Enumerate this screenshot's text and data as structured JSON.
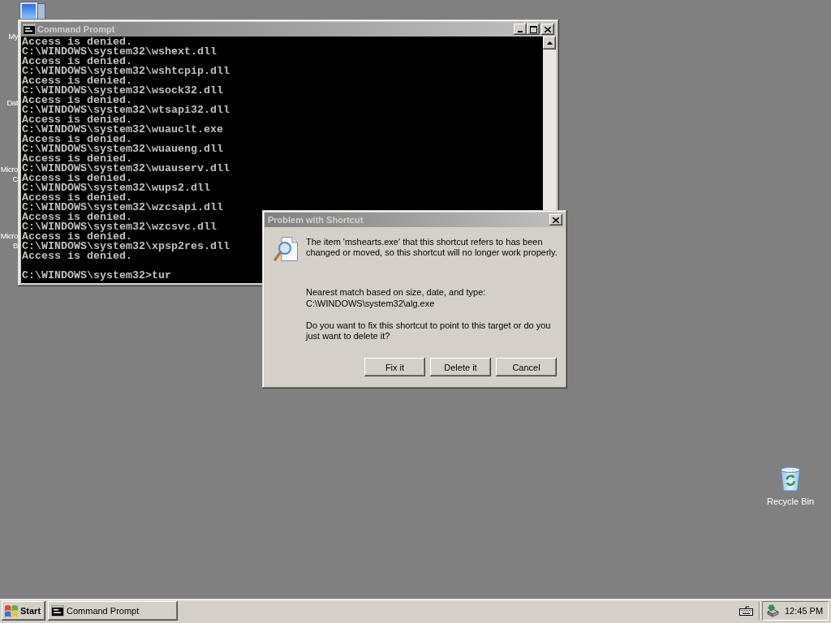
{
  "desktop": {
    "left_icons": [
      {
        "kind": "computer",
        "label_lines": [
          "My"
        ]
      },
      {
        "kind": "label_only",
        "label_lines": [
          "Dat"
        ]
      },
      {
        "kind": "label_only",
        "label_lines": [
          "Micro",
          "C"
        ]
      },
      {
        "kind": "label_only",
        "label_lines": [
          "Micro",
          "B"
        ]
      }
    ],
    "recycle_bin": {
      "label": "Recycle Bin"
    }
  },
  "console": {
    "title": "Command Prompt",
    "active": false,
    "output_lines": [
      "Access is denied.",
      "C:\\WINDOWS\\system32\\wshext.dll",
      "Access is denied.",
      "C:\\WINDOWS\\system32\\wshtcpip.dll",
      "Access is denied.",
      "C:\\WINDOWS\\system32\\wsock32.dll",
      "Access is denied.",
      "C:\\WINDOWS\\system32\\wtsapi32.dll",
      "Access is denied.",
      "C:\\WINDOWS\\system32\\wuauclt.exe",
      "Access is denied.",
      "C:\\WINDOWS\\system32\\wuaueng.dll",
      "Access is denied.",
      "C:\\WINDOWS\\system32\\wuauserv.dll",
      "Access is denied.",
      "C:\\WINDOWS\\system32\\wups2.dll",
      "Access is denied.",
      "C:\\WINDOWS\\system32\\wzcsapi.dll",
      "Access is denied.",
      "C:\\WINDOWS\\system32\\wzcsvc.dll",
      "Access is denied.",
      "C:\\WINDOWS\\system32\\xpsp2res.dll",
      "Access is denied."
    ],
    "prompt": "C:\\WINDOWS\\system32>tur"
  },
  "dialog": {
    "title": "Problem with Shortcut",
    "active": false,
    "message": "The item 'mshearts.exe' that this shortcut refers to has been changed or moved, so this shortcut will no longer work properly.",
    "match_label": "Nearest match based on size, date, and type:",
    "match_path": "C:\\WINDOWS\\system32\\alg.exe",
    "question": "Do you want to fix this shortcut to point to this target or do you just want to delete it?",
    "buttons": [
      {
        "label": "Fix it"
      },
      {
        "label": "Delete it"
      },
      {
        "label": "Cancel"
      }
    ]
  },
  "taskbar": {
    "start_label": "Start",
    "tasks": [
      {
        "label": "Command Prompt",
        "selected": false
      }
    ],
    "clock": "12:45 PM"
  }
}
